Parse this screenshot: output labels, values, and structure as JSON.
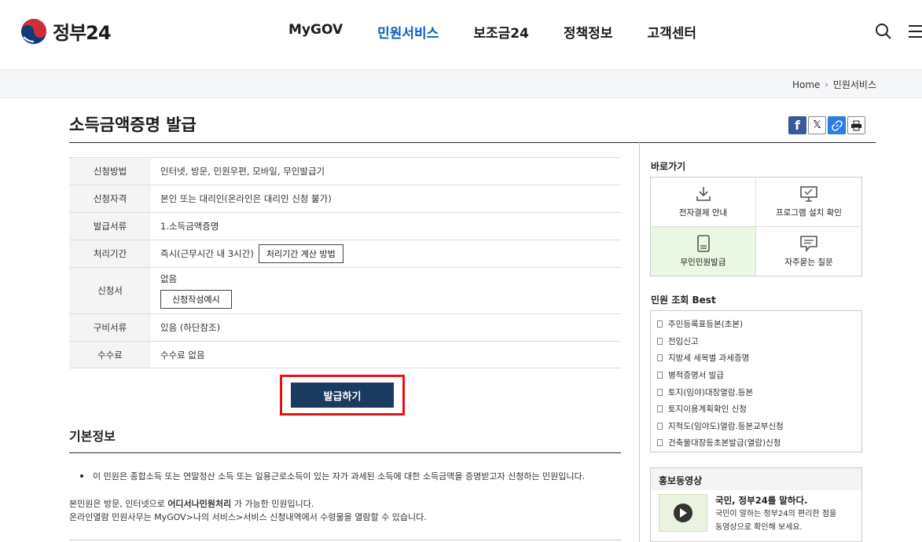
{
  "header": {
    "logo_text": "정부24",
    "nav": [
      "MyGOV",
      "민원서비스",
      "보조금24",
      "정책정보",
      "고객센터"
    ],
    "active_nav": "민원서비스",
    "icons": [
      "search-icon",
      "menu-icon"
    ]
  },
  "breadcrumb": {
    "home": "Home",
    "current": "민원서비스"
  },
  "page": {
    "title": "소득금액증명 발급"
  },
  "share": {
    "icons": [
      "facebook-icon",
      "x-icon",
      "link-icon",
      "print-icon"
    ]
  },
  "info": {
    "method_label": "신청방법",
    "method": "인터넷, 방문, 민원우편, 모바일, 무인발급기",
    "qualification_label": "신청자격",
    "qualification": "본인 또는 대리인(온라인은 대리인 신청 불가)",
    "document_label": "발급서류",
    "document": "1.소득금액증명",
    "period_label": "처리기간",
    "period": "즉시(근무시간 내 3시간)",
    "period_button": "처리기간 계산 방법",
    "form_label": "신청서",
    "form": "없음",
    "form_button": "신청작성예시",
    "required_label": "구비서류",
    "required": "있음 (하단참조)",
    "fee_label": "수수료",
    "fee": "수수료 없음"
  },
  "apply_button": "발급하기",
  "basic": {
    "title": "기본정보",
    "bullet": "이 민원은 종합소득 또는 연말정산 소득 또는 일용근로소득이 있는 자가 과세된 소득에 대한 소득금액을 증명받고자 신청하는 민원입니다.",
    "line1_a": "본민원은 방문, 인터넷으로 ",
    "line1_b": "어디서나민원처리",
    "line1_c": " 가 가능한 민원입니다.",
    "line2": "온라인열람 민원사무는 MyGOV>나의 서비스>서비스 신청내역에서 수령물을 열람할 수 있습니다."
  },
  "sidebar": {
    "quick_title": "바로가기",
    "quick": [
      {
        "label": "전자결제 안내",
        "icon": "download-icon"
      },
      {
        "label": "프로그램 설치 확인",
        "icon": "monitor-icon"
      },
      {
        "label": "무인민원발급",
        "icon": "kiosk-icon"
      },
      {
        "label": "자주묻는 질문",
        "icon": "chat-icon"
      }
    ],
    "best_title": "민원 조회 Best",
    "best": [
      "주민등록표등본(초본)",
      "전입신고",
      "지방세 세목별 과세증명",
      "병적증명서 발급",
      "토지(임야)대장열람.등본",
      "토지이용계획확인 신청",
      "지적도(임야도)열람.등본교부신청",
      "건축물대장등초본발급(열람)신청"
    ],
    "promo_title": "홍보동영상",
    "promo_head": "국민, 정부24를 말하다.",
    "promo_desc1": "국민이 말하는 정부24의 편리한 점을",
    "promo_desc2": "동영상으로 확인해 보세요."
  }
}
